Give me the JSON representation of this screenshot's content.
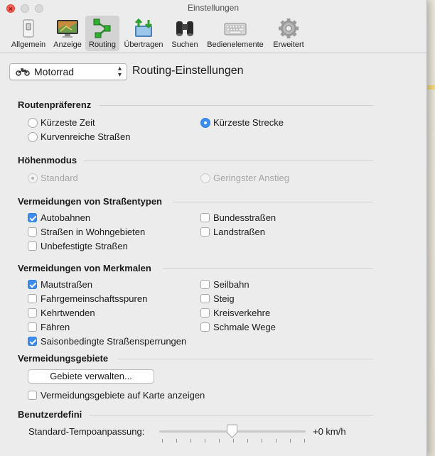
{
  "window": {
    "title": "Einstellungen"
  },
  "toolbar": [
    {
      "label": "Allgemein",
      "icon": "switch-icon"
    },
    {
      "label": "Anzeige",
      "icon": "display-icon"
    },
    {
      "label": "Routing",
      "icon": "routing-icon",
      "active": true
    },
    {
      "label": "Übertragen",
      "icon": "transfer-icon"
    },
    {
      "label": "Suchen",
      "icon": "binoculars-icon"
    },
    {
      "label": "Bedienelemente",
      "icon": "keyboard-icon"
    },
    {
      "label": "Erweitert",
      "icon": "gear-icon"
    }
  ],
  "header": {
    "profile": "Motorrad",
    "title": "Routing-Einstellungen"
  },
  "sections": {
    "routing_preference": {
      "title": "Routenpräferenz",
      "options": [
        "Kürzeste Zeit",
        "Kürzeste Strecke",
        "Kurvenreiche Straßen"
      ],
      "selected": "Kürzeste Strecke"
    },
    "elevation_mode": {
      "title": "Höhenmodus",
      "options": [
        "Standard",
        "Geringster Anstieg"
      ],
      "selected": "Standard",
      "disabled": true
    },
    "avoid_road_types": {
      "title": "Vermeidungen von Straßentypen",
      "items": [
        {
          "label": "Autobahnen",
          "checked": true
        },
        {
          "label": "Bundesstraßen",
          "checked": false
        },
        {
          "label": "Straßen in Wohngebieten",
          "checked": false
        },
        {
          "label": "Landstraßen",
          "checked": false
        },
        {
          "label": "Unbefestigte Straßen",
          "checked": false
        }
      ]
    },
    "avoid_features": {
      "title": "Vermeidungen von Merkmalen",
      "items": [
        {
          "label": "Mautstraßen",
          "checked": true
        },
        {
          "label": "Seilbahn",
          "checked": false
        },
        {
          "label": "Fahrgemeinschaftsspuren",
          "checked": false
        },
        {
          "label": "Steig",
          "checked": false
        },
        {
          "label": "Kehrtwenden",
          "checked": false
        },
        {
          "label": "Kreisverkehre",
          "checked": false
        },
        {
          "label": "Fähren",
          "checked": false
        },
        {
          "label": "Schmale Wege",
          "checked": false
        },
        {
          "label": "Saisonbedingte Straßensperrungen",
          "checked": true
        }
      ]
    },
    "avoid_areas": {
      "title": "Vermeidungsgebiete",
      "button": "Gebiete verwalten...",
      "show_on_map": {
        "label": "Vermeidungsgebiete auf Karte anzeigen",
        "checked": false
      }
    },
    "custom": {
      "title": "Benutzerdefini",
      "slider_label": "Standard-Tempoanpassung:",
      "slider_value": "+0 km/h",
      "slider_position": 0.5
    }
  },
  "colors": {
    "accent": "#3b8df0",
    "close": "#fc5f57"
  }
}
